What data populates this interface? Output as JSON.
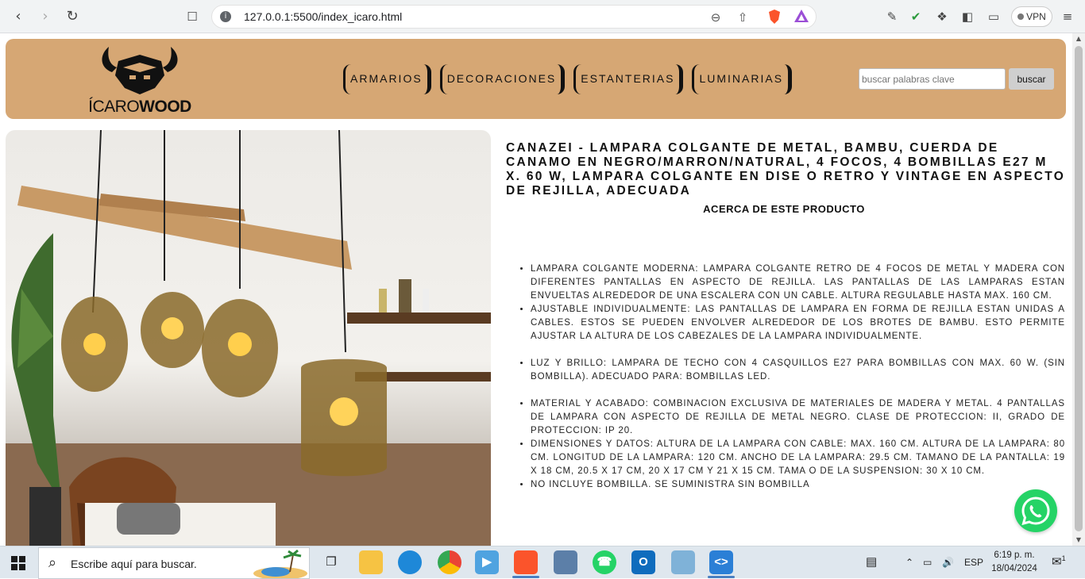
{
  "browser": {
    "url": "127.0.0.1:5500/index_icaro.html",
    "vpn_label": "VPN"
  },
  "site": {
    "logo_text_light": "ÍCARO",
    "logo_text_bold": "WOOD",
    "nav": [
      "ARMARIOS",
      "DECORACIONES",
      "ESTANTERIAS",
      "LUMINARIAS"
    ],
    "search_placeholder": "buscar palabras clave",
    "search_button": "buscar"
  },
  "product": {
    "title": "CANAZEI - LAMPARA COLGANTE DE METAL, BAMBU, CUERDA DE CANAMO EN NEGRO/MARRON/NATURAL, 4 FOCOS, 4 BOMBILLAS E27 M  X. 60 W, LAMPARA COLGANTE EN DISE  O RETRO Y VINTAGE EN ASPECTO DE REJILLA, ADECUADA",
    "about_heading": "ACERCA DE ESTE PRODUCTO",
    "features": [
      "LAMPARA COLGANTE MODERNA: LAMPARA COLGANTE RETRO DE 4 FOCOS DE METAL Y MADERA CON DIFERENTES PANTALLAS EN ASPECTO DE REJILLA. LAS PANTALLAS DE LAS LAMPARAS ESTAN ENVUELTAS ALREDEDOR DE UNA ESCALERA CON UN CABLE. ALTURA REGULABLE HASTA MAX. 160 CM.",
      "AJUSTABLE INDIVIDUALMENTE: LAS PANTALLAS DE LAMPARA EN FORMA DE REJILLA ESTAN UNIDAS A CABLES. ESTOS SE PUEDEN ENVOLVER ALREDEDOR DE LOS BROTES DE BAMBU. ESTO PERMITE AJUSTAR LA ALTURA DE LOS CABEZALES DE LA LAMPARA INDIVIDUALMENTE.",
      "LUZ Y BRILLO: LAMPARA DE TECHO CON 4 CASQUILLOS E27 PARA BOMBILLAS CON MAX. 60 W. (SIN BOMBILLA). ADECUADO PARA: BOMBILLAS LED.",
      "MATERIAL Y ACABADO: COMBINACION EXCLUSIVA DE MATERIALES DE MADERA Y METAL. 4 PANTALLAS DE LAMPARA CON ASPECTO DE REJILLA DE METAL NEGRO. CLASE DE PROTECCION: II, GRADO DE PROTECCION: IP 20.",
      "DIMENSIONES Y DATOS: ALTURA DE LA LAMPARA CON CABLE: MAX. 160 CM. ALTURA DE LA LAMPARA: 80 CM. LONGITUD DE LA LAMPARA: 120 CM. ANCHO DE LA LAMPARA: 29.5 CM. TAMANO DE LA PANTALLA: 19 X 18 CM, 20.5 X 17 CM, 20 X 17 CM Y 21 X 15 CM. TAMA  O DE LA SUSPENSION: 30 X 10 CM.",
      "NO INCLUYE BOMBILLA. SE SUMINISTRA SIN BOMBILLA"
    ]
  },
  "taskbar": {
    "search_placeholder": "Escribe aquí para buscar.",
    "language": "ESP",
    "time": "6:19 p. m.",
    "date": "18/04/2024",
    "notification_count": "1"
  },
  "colors": {
    "header_bg": "#d6a774",
    "whatsapp": "#25d366",
    "taskbar_bg": "#dfe7ee"
  }
}
